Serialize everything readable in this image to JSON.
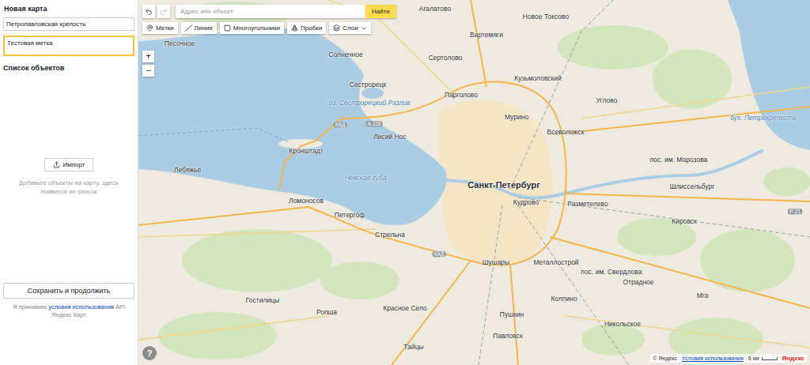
{
  "sidebar": {
    "title": "Новая карта",
    "map_name": "Петропавловская крепость",
    "description": "Тестовая метка",
    "description_focused": true,
    "objects_title": "Список объектов",
    "import_button": "Импорт",
    "empty_hint": "Добавьте объекты на карту, здесь появится их список",
    "save_button": "Сохранить и продолжить",
    "terms_before": "Я принимаю",
    "terms_link": "условия использования",
    "terms_after": "API Яндекс Карт"
  },
  "toolbar": {
    "undo_disabled": false,
    "redo_disabled": true,
    "search_placeholder": "Адрес или объект",
    "search_button": "Найти",
    "tools": [
      {
        "label": "Метки",
        "kind": "button",
        "selected": false
      },
      {
        "label": "Линии",
        "kind": "button",
        "selected": false
      },
      {
        "label": "Многоугольники",
        "kind": "button",
        "selected": false
      },
      {
        "label": "Пробки",
        "kind": "button",
        "selected": false
      },
      {
        "label": "Слои",
        "kind": "menu",
        "selected": false
      }
    ]
  },
  "zoom": {
    "in": "+",
    "out": "−"
  },
  "map": {
    "labels": [
      {
        "text": "Агалатово",
        "kind": "town"
      },
      {
        "text": "Новое Токсово",
        "kind": "town"
      },
      {
        "text": "Вартемяги",
        "kind": "town"
      },
      {
        "text": "Песочное",
        "kind": "town"
      },
      {
        "text": "Солнечное",
        "kind": "town"
      },
      {
        "text": "Сертолово",
        "kind": "town"
      },
      {
        "text": "Кузьмоловский",
        "kind": "town"
      },
      {
        "text": "Сестрорецк",
        "kind": "town"
      },
      {
        "text": "оз. Сестрорецкий Разлив",
        "kind": "water"
      },
      {
        "text": "Парголово",
        "kind": "town"
      },
      {
        "text": "Мурино",
        "kind": "town"
      },
      {
        "text": "Углово",
        "kind": "town"
      },
      {
        "text": "Всеволожск",
        "kind": "town"
      },
      {
        "text": "Лисий Нос",
        "kind": "town"
      },
      {
        "text": "Кронштадт",
        "kind": "town"
      },
      {
        "text": "пос. им. Морозова",
        "kind": "town"
      },
      {
        "text": "бух. Петрокрепость",
        "kind": "water"
      },
      {
        "text": "Лебяжье",
        "kind": "town"
      },
      {
        "text": "Невская губа",
        "kind": "water"
      },
      {
        "text": "Санкт-Петербург",
        "kind": "city"
      },
      {
        "text": "Шлиссельбург",
        "kind": "town"
      },
      {
        "text": "Ломоносов",
        "kind": "town"
      },
      {
        "text": "Кудрово",
        "kind": "town"
      },
      {
        "text": "Разметелево",
        "kind": "town"
      },
      {
        "text": "Петергоф",
        "kind": "town"
      },
      {
        "text": "Кировск",
        "kind": "town"
      },
      {
        "text": "Стрельна",
        "kind": "town"
      },
      {
        "text": "Шушары",
        "kind": "town"
      },
      {
        "text": "Металлострой",
        "kind": "town"
      },
      {
        "text": "пос. им. Свердлова",
        "kind": "town"
      },
      {
        "text": "Отрадное",
        "kind": "town"
      },
      {
        "text": "Мга",
        "kind": "town"
      },
      {
        "text": "Колпино",
        "kind": "town"
      },
      {
        "text": "Гостилицы",
        "kind": "town"
      },
      {
        "text": "Красное Село",
        "kind": "town"
      },
      {
        "text": "Ропша",
        "kind": "town"
      },
      {
        "text": "Пушкин",
        "kind": "town"
      },
      {
        "text": "Никольское",
        "kind": "town"
      },
      {
        "text": "Павловск",
        "kind": "town"
      },
      {
        "text": "Тайцы",
        "kind": "town"
      },
      {
        "text": "КАД",
        "kind": "road"
      },
      {
        "text": "А-118",
        "kind": "road"
      },
      {
        "text": "Р-21",
        "kind": "road"
      },
      {
        "text": "КАД",
        "kind": "road"
      }
    ]
  },
  "footer": {
    "help": "?",
    "scale": "6 км",
    "copyright": "© Яндекс",
    "terms": "Условия использования",
    "logo": "Яндекс"
  }
}
